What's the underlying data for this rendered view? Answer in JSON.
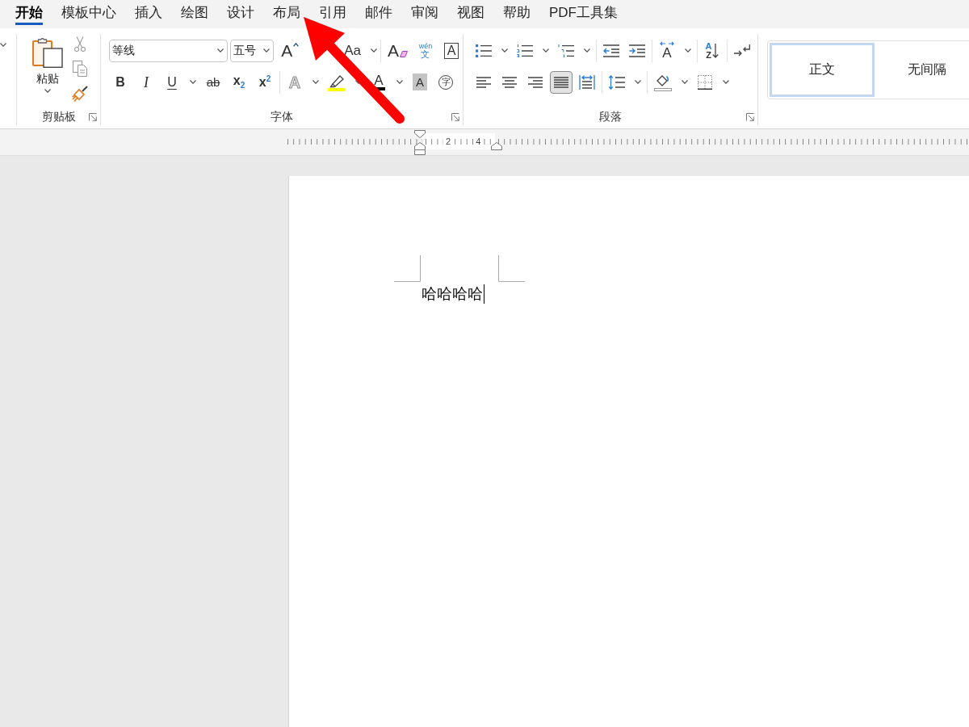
{
  "tabs": [
    {
      "label": "开始",
      "selected": true
    },
    {
      "label": "模板中心",
      "selected": false
    },
    {
      "label": "插入",
      "selected": false
    },
    {
      "label": "绘图",
      "selected": false
    },
    {
      "label": "设计",
      "selected": false
    },
    {
      "label": "布局",
      "selected": false
    },
    {
      "label": "引用",
      "selected": false
    },
    {
      "label": "邮件",
      "selected": false
    },
    {
      "label": "审阅",
      "selected": false
    },
    {
      "label": "视图",
      "selected": false
    },
    {
      "label": "帮助",
      "selected": false
    },
    {
      "label": "PDF工具集",
      "selected": false
    }
  ],
  "clipboard": {
    "paste_label": "粘贴",
    "group_label": "剪贴板"
  },
  "font": {
    "font_name": "等线",
    "font_size": "五号",
    "row_1": [
      [
        {
          "kind": "grow-font",
          "glyph": "A",
          "dropdown": false
        }
      ],
      [
        {
          "kind": "change-case",
          "glyph": "Aa",
          "dropdown": true
        }
      ],
      [
        {
          "kind": "clear-format",
          "glyph": "A",
          "dropdown": false
        },
        {
          "kind": "phonetic-guide",
          "glyph": "wén",
          "glyph_lower": "文",
          "dropdown": false
        },
        {
          "kind": "character-border",
          "glyph": "A",
          "dropdown": false
        }
      ]
    ],
    "row_2": [
      [
        {
          "kind": "bold",
          "glyph": "B",
          "dropdown": false
        },
        {
          "kind": "italic",
          "glyph": "I",
          "dropdown": false
        },
        {
          "kind": "underline",
          "glyph": "U",
          "dropdown": true
        },
        {
          "kind": "strikethrough",
          "glyph": "ab",
          "dropdown": false
        },
        {
          "kind": "subscript",
          "glyph": "x$_{2}$",
          "dropdown": false
        },
        {
          "kind": "superscript",
          "glyph": "x$^{2}$",
          "dropdown": false
        }
      ],
      [
        {
          "kind": "text-effect",
          "glyph": "A",
          "dropdown": true
        },
        {
          "kind": "highlight",
          "dropdown": true
        },
        {
          "kind": "font-color",
          "glyph": "A",
          "dropdown": true
        },
        {
          "kind": "character-shading",
          "glyph": "A",
          "dropdown": false
        },
        {
          "kind": "enclose-character",
          "glyph": "字",
          "dropdown": false
        }
      ]
    ],
    "group_label": "字体"
  },
  "paragraph": {
    "row_1": [
      [
        {
          "kind": "bulleted-list",
          "dropdown": true
        },
        {
          "kind": "numbered-list",
          "dropdown": true
        },
        {
          "kind": "multilevel-list",
          "dropdown": true
        }
      ],
      [
        {
          "kind": "decrease-indent",
          "dropdown": false
        },
        {
          "kind": "increase-indent",
          "dropdown": false
        }
      ],
      [
        {
          "kind": "text-direction",
          "glyph": "A",
          "dropdown": true
        }
      ],
      [
        {
          "kind": "sort",
          "glyph": "A",
          "glyph_lower": "Z",
          "dropdown": false
        }
      ],
      [
        {
          "kind": "show-marks",
          "dropdown": false
        }
      ]
    ],
    "row_2": [
      [
        {
          "kind": "align-left",
          "selected": false,
          "dropdown": false
        },
        {
          "kind": "align-center",
          "selected": false,
          "dropdown": false
        },
        {
          "kind": "align-right",
          "selected": false,
          "dropdown": false
        },
        {
          "kind": "justify",
          "selected": true,
          "dropdown": false
        },
        {
          "kind": "distribute",
          "selected": false,
          "dropdown": false
        }
      ],
      [
        {
          "kind": "line-spacing",
          "dropdown": true
        }
      ],
      [
        {
          "kind": "shading",
          "dropdown": true
        },
        {
          "kind": "borders",
          "dropdown": true
        }
      ]
    ],
    "group_label": "段落"
  },
  "styles": [
    {
      "label": "正文",
      "selected": true
    },
    {
      "label": "无间隔",
      "selected": false
    }
  ],
  "ruler": {
    "labels": [
      "2",
      "4"
    ]
  },
  "document": {
    "text": "哈哈哈哈"
  }
}
